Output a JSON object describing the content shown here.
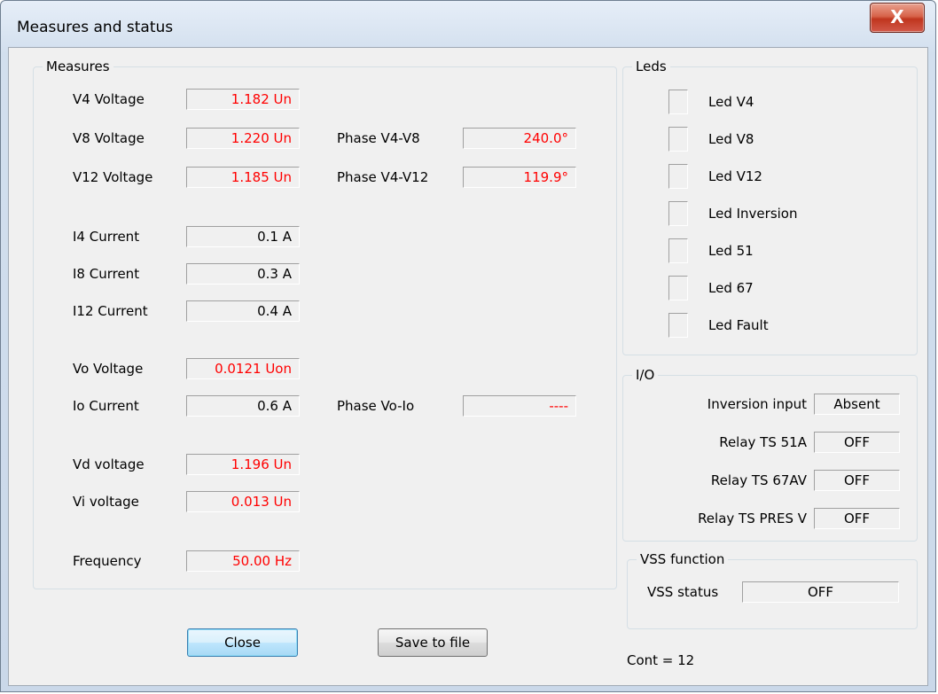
{
  "window": {
    "title": "Measures and status",
    "close_glyph": "X"
  },
  "measures": {
    "title": "Measures",
    "rows": [
      {
        "label": "V4 Voltage",
        "value": "1.182 Un",
        "color": "#ff0000"
      },
      {
        "label": "V8 Voltage",
        "value": "1.220 Un",
        "color": "#ff0000"
      },
      {
        "label": "V12 Voltage",
        "value": "1.185 Un",
        "color": "#ff0000"
      },
      {
        "label": "I4 Current",
        "value": "0.1 A",
        "color": "#000000"
      },
      {
        "label": "I8 Current",
        "value": "0.3 A",
        "color": "#000000"
      },
      {
        "label": "I12 Current",
        "value": "0.4 A",
        "color": "#000000"
      },
      {
        "label": "Vo Voltage",
        "value": "0.0121 Uon",
        "color": "#ff0000"
      },
      {
        "label": "Io Current",
        "value": "0.6 A",
        "color": "#000000"
      },
      {
        "label": "Vd voltage",
        "value": "1.196 Un",
        "color": "#ff0000"
      },
      {
        "label": "Vi voltage",
        "value": "0.013 Un",
        "color": "#ff0000"
      },
      {
        "label": "Frequency",
        "value": "50.00 Hz",
        "color": "#ff0000"
      }
    ],
    "phases": [
      {
        "label": "Phase V4-V8",
        "value": "240.0°",
        "color": "#ff0000"
      },
      {
        "label": "Phase V4-V12",
        "value": "119.9°",
        "color": "#ff0000"
      },
      {
        "label": "Phase Vo-Io",
        "value": "----",
        "color": "#ff0000"
      }
    ]
  },
  "leds": {
    "title": "Leds",
    "items": [
      {
        "label": "Led V4",
        "on": false
      },
      {
        "label": "Led V8",
        "on": false
      },
      {
        "label": "Led V12",
        "on": false
      },
      {
        "label": "Led Inversion",
        "on": false
      },
      {
        "label": "Led 51",
        "on": false
      },
      {
        "label": "Led 67",
        "on": false
      },
      {
        "label": "Led Fault",
        "on": false
      }
    ]
  },
  "io": {
    "title": "I/O",
    "items": [
      {
        "label": "Inversion input",
        "value": "Absent"
      },
      {
        "label": "Relay TS 51A",
        "value": "OFF"
      },
      {
        "label": "Relay TS 67AV",
        "value": "OFF"
      },
      {
        "label": "Relay TS PRES V",
        "value": "OFF"
      }
    ]
  },
  "vss": {
    "title": "VSS function",
    "label": "VSS status",
    "value": "OFF"
  },
  "buttons": {
    "close": "Close",
    "save": "Save to file"
  },
  "counter": "Cont = 12"
}
